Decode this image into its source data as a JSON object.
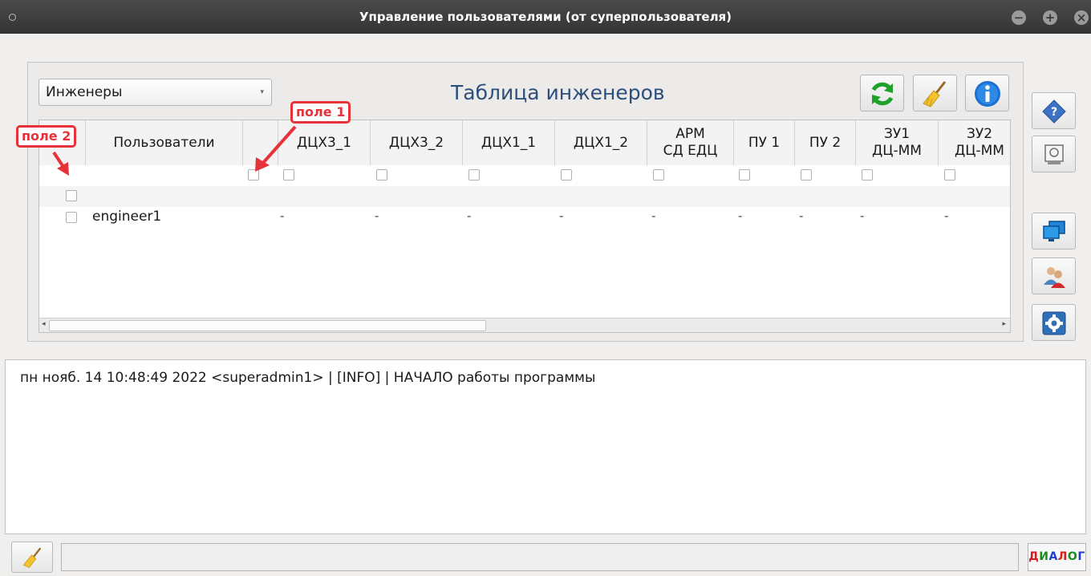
{
  "window": {
    "title": "Управление пользователями (от суперпользователя)",
    "minimize_glyph": "−",
    "maximize_glyph": "+",
    "close_glyph": "×"
  },
  "role_selector": {
    "value": "Инженеры",
    "arrow": "▾"
  },
  "table_title": "Таблица инженеров",
  "toolbar": {
    "icons": [
      "refresh-icon",
      "broom-icon",
      "info-icon"
    ]
  },
  "table": {
    "columns": [
      {
        "label": ""
      },
      {
        "label": "Пользователи"
      },
      {
        "label": ""
      },
      {
        "label": "ДЦХ3_1"
      },
      {
        "label": "ДЦХ3_2"
      },
      {
        "label": "ДЦХ1_1"
      },
      {
        "label": "ДЦХ1_2"
      },
      {
        "label": "АРМ\nСД ЕДЦ"
      },
      {
        "label": "ПУ 1"
      },
      {
        "label": "ПУ 2"
      },
      {
        "label": "ЗУ1\nДЦ-ММ"
      },
      {
        "label": "ЗУ2\nДЦ-ММ"
      }
    ],
    "rows": [
      {
        "user": "",
        "values": []
      },
      {
        "user": "engineer1",
        "values": [
          "-",
          "-",
          "-",
          "-",
          "-",
          "-",
          "-",
          "-",
          "-"
        ]
      }
    ]
  },
  "annotations": {
    "field1": "поле 1",
    "field2": "поле 2",
    "color": "#e8323a"
  },
  "side_tools": [
    "help-icon",
    "monitor-icon",
    "monitors-icon",
    "users-icon",
    "settings-icon"
  ],
  "log": {
    "lines": [
      "пн нояб. 14 10:48:49 2022 <superadmin1> | [INFO] | НАЧАЛО работы программы"
    ]
  },
  "status_bar": {
    "message": "",
    "dialog_letters": [
      "Д",
      "И",
      "А",
      "Л",
      "О",
      "Г"
    ],
    "dialog_colors": [
      "#d21f1f",
      "#1b8c1b",
      "#1f3fd2",
      "#d21f1f",
      "#1b8c1b",
      "#1f3fd2"
    ]
  }
}
